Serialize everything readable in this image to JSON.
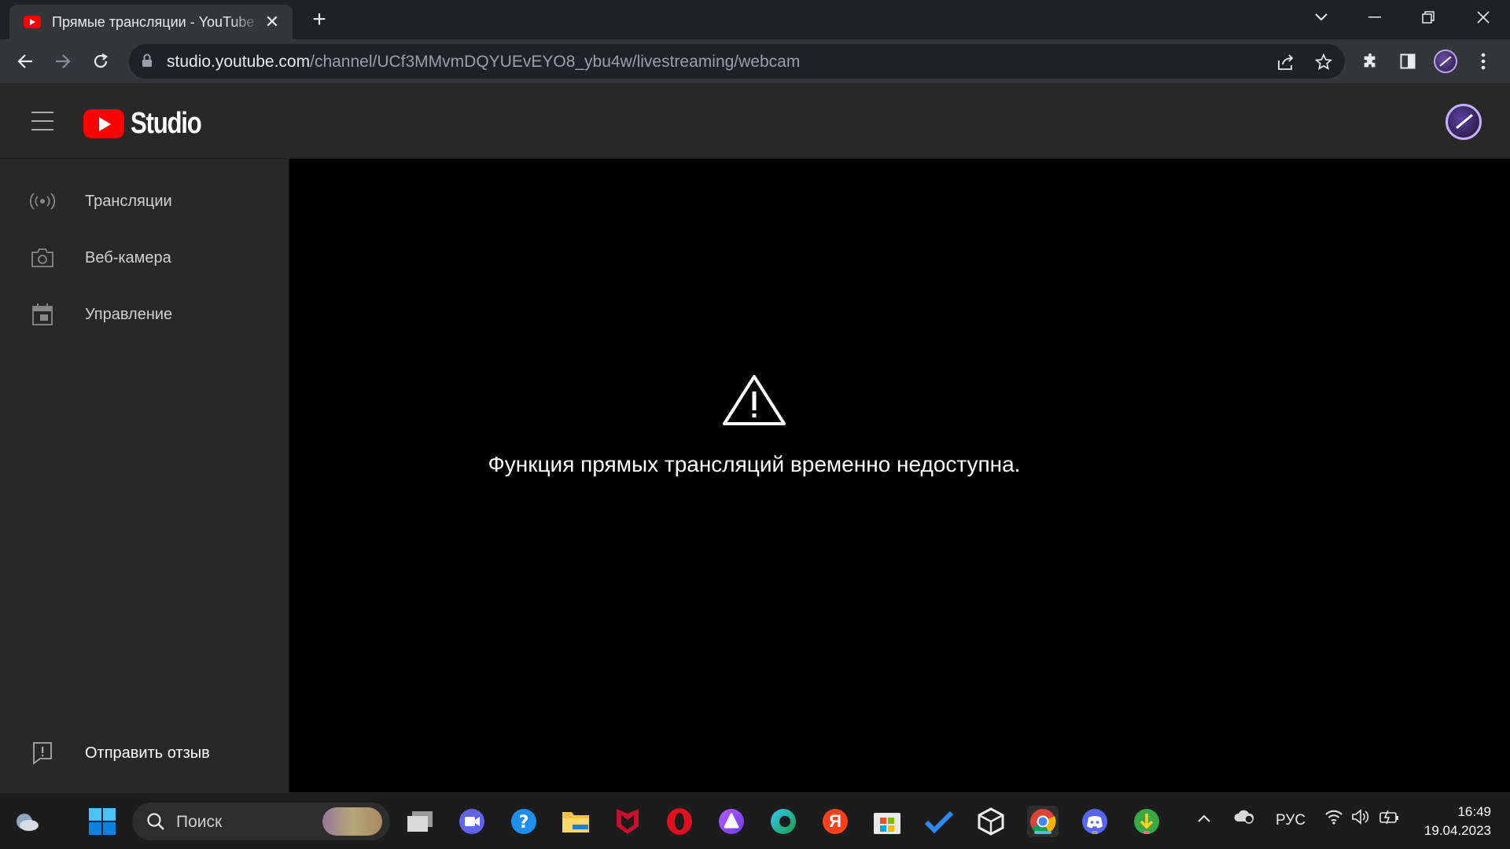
{
  "browser": {
    "tab_title": "Прямые трансляции - YouTube Studio",
    "tab_close": "✕",
    "new_tab": "+",
    "url_host": "studio.youtube.com",
    "url_path": "/channel/UCf3MMvmDQYUEvEYO8_ybu4w/livestreaming/webcam"
  },
  "header": {
    "logo_text": "Studio"
  },
  "sidebar": {
    "items": [
      {
        "label": "Трансляции",
        "icon": "broadcast-icon"
      },
      {
        "label": "Веб-камера",
        "icon": "camera-icon"
      },
      {
        "label": "Управление",
        "icon": "calendar-icon"
      }
    ],
    "feedback_label": "Отправить отзыв"
  },
  "main": {
    "message": "Функция прямых трансляций временно недоступна."
  },
  "taskbar": {
    "search_placeholder": "Поиск",
    "language": "РУС",
    "time": "16:49",
    "date": "19.04.2023",
    "yandex_letter": "Я"
  },
  "colors": {
    "accent_red": "#ff0000",
    "sidebar_bg": "#282828",
    "main_bg": "#000000"
  }
}
